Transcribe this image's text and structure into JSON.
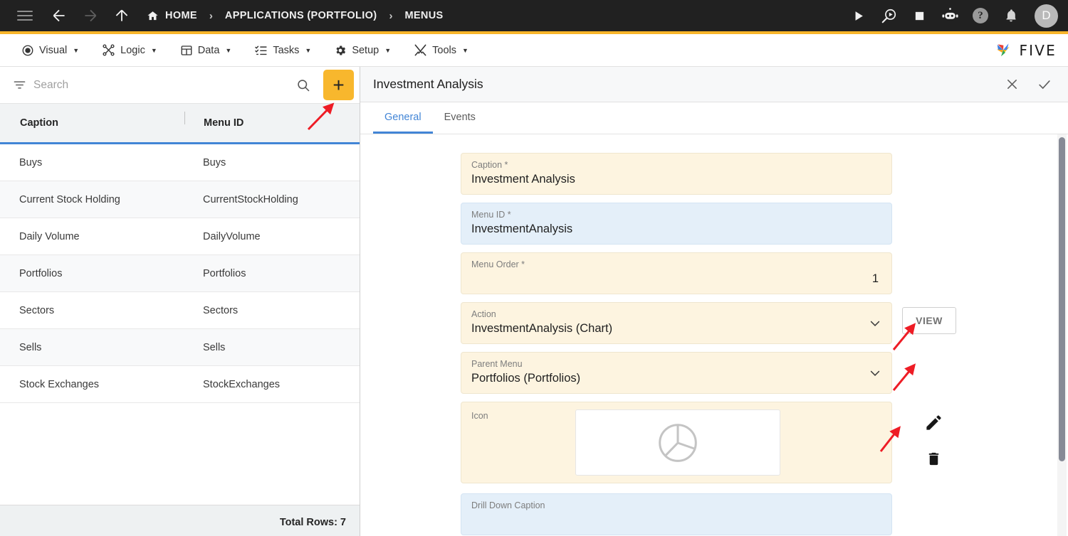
{
  "topbar": {
    "menu_icon": "hamburger-icon",
    "back_icon": "arrow-left-icon",
    "forward_icon": "arrow-right-icon",
    "up_icon": "arrow-up-icon",
    "breadcrumbs": [
      {
        "label": "HOME",
        "icon": "home-icon"
      },
      {
        "label": "APPLICATIONS (PORTFOLIO)",
        "icon": ""
      },
      {
        "label": "MENUS",
        "icon": ""
      }
    ],
    "separator": "›",
    "actions": [
      {
        "name": "run-icon",
        "label": "Run"
      },
      {
        "name": "debug-icon",
        "label": "Debug"
      },
      {
        "name": "stop-icon",
        "label": "Stop"
      },
      {
        "name": "bot-icon",
        "label": "Assistant"
      },
      {
        "name": "help-icon",
        "label": "?"
      },
      {
        "name": "notifications-bell-icon",
        "label": "Notifications"
      }
    ],
    "avatar_initial": "D",
    "accent_color": "#f7b52a",
    "background_color": "#212121"
  },
  "menubar": {
    "items": [
      {
        "label": "Visual",
        "icon": "eye-icon",
        "caret": "▼"
      },
      {
        "label": "Logic",
        "icon": "logic-nodes-icon",
        "caret": "▼"
      },
      {
        "label": "Data",
        "icon": "table-grid-icon",
        "caret": "▼"
      },
      {
        "label": "Tasks",
        "icon": "checklist-icon",
        "caret": "▼"
      },
      {
        "label": "Setup",
        "icon": "gear-icon",
        "caret": "▼"
      },
      {
        "label": "Tools",
        "icon": "tools-cross-icon",
        "caret": "▼"
      }
    ],
    "brand": "FIVE"
  },
  "left_pane": {
    "search": {
      "placeholder": "Search",
      "value": ""
    },
    "add_button_label": "+",
    "columns": [
      "Caption",
      "Menu ID"
    ],
    "rows": [
      {
        "caption": "Buys",
        "menu_id": "Buys"
      },
      {
        "caption": "Current Stock Holding",
        "menu_id": "CurrentStockHolding"
      },
      {
        "caption": "Daily Volume",
        "menu_id": "DailyVolume"
      },
      {
        "caption": "Portfolios",
        "menu_id": "Portfolios"
      },
      {
        "caption": "Sectors",
        "menu_id": "Sectors"
      },
      {
        "caption": "Sells",
        "menu_id": "Sells"
      },
      {
        "caption": "Stock Exchanges",
        "menu_id": "StockExchanges"
      }
    ],
    "footer": "Total Rows: 7"
  },
  "right_pane": {
    "title": "Investment Analysis",
    "close_label": "✕",
    "confirm_label": "✓",
    "tabs": [
      {
        "label": "General",
        "active": true
      },
      {
        "label": "Events",
        "active": false
      }
    ],
    "fields": {
      "caption": {
        "label": "Caption *",
        "value": "Investment Analysis"
      },
      "menu_id": {
        "label": "Menu ID *",
        "value": "InvestmentAnalysis"
      },
      "menu_order": {
        "label": "Menu Order *",
        "value": "1"
      },
      "action": {
        "label": "Action",
        "value": "InvestmentAnalysis (Chart)",
        "button": "VIEW"
      },
      "parent_menu": {
        "label": "Parent Menu",
        "value": "Portfolios (Portfolios)"
      },
      "icon": {
        "label": "Icon",
        "preview_icon": "pie-chart-icon",
        "edit_icon": "pencil-icon",
        "delete_icon": "trash-icon"
      },
      "drill_down_caption": {
        "label": "Drill Down Caption",
        "value": ""
      }
    }
  },
  "annotations": {
    "color": "#ee1c25",
    "arrows": [
      "points-to-add-button",
      "points-to-action-dropdown",
      "points-to-parent-menu-dropdown",
      "points-to-icon-edit-pencil"
    ]
  }
}
